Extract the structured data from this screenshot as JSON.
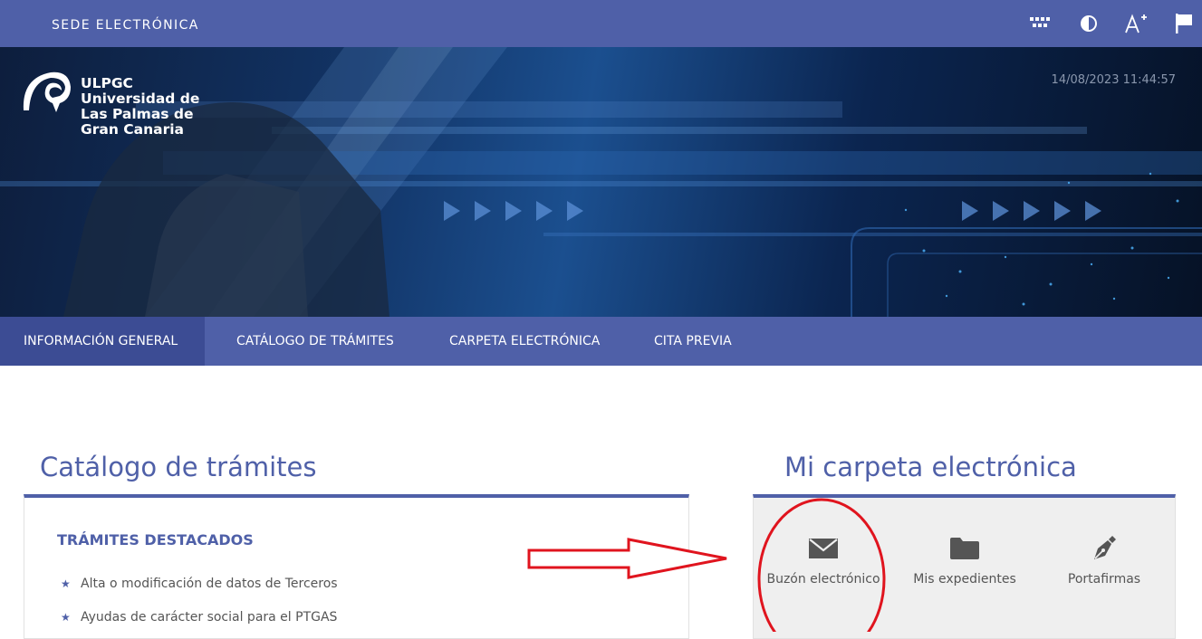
{
  "topbar": {
    "site_name": "SEDE ELECTRÓNICA",
    "tools": [
      "sitemap-icon",
      "contrast-icon",
      "font-size-icon",
      "language-flag-icon"
    ]
  },
  "banner": {
    "logo": {
      "acronym": "ULPGC",
      "line1": "Universidad de",
      "line2": "Las Palmas de",
      "line3": "Gran Canaria"
    },
    "datetime": "14/08/2023 11:44:57"
  },
  "nav": {
    "items": [
      {
        "label": "INFORMACIÓN GENERAL",
        "active": true
      },
      {
        "label": "CATÁLOGO DE TRÁMITES",
        "active": false
      },
      {
        "label": "CARPETA ELECTRÓNICA",
        "active": false
      },
      {
        "label": "CITA PREVIA",
        "active": false
      }
    ]
  },
  "catalog": {
    "title": "Catálogo de trámites",
    "subhead": "TRÁMITES DESTACADOS",
    "items": [
      "Alta o modificación de datos de Terceros",
      "Ayudas de carácter social para el PTGAS"
    ]
  },
  "folder": {
    "title": "Mi carpeta electrónica",
    "tiles": [
      {
        "label": "Buzón electrónico",
        "icon": "envelope-icon"
      },
      {
        "label": "Mis expedientes",
        "icon": "folder-icon"
      },
      {
        "label": "Portafirmas",
        "icon": "pen-nib-icon"
      }
    ]
  },
  "colors": {
    "brand": "#4f60a8",
    "brand_dark": "#3c4c94",
    "annotation": "#e0141e"
  }
}
